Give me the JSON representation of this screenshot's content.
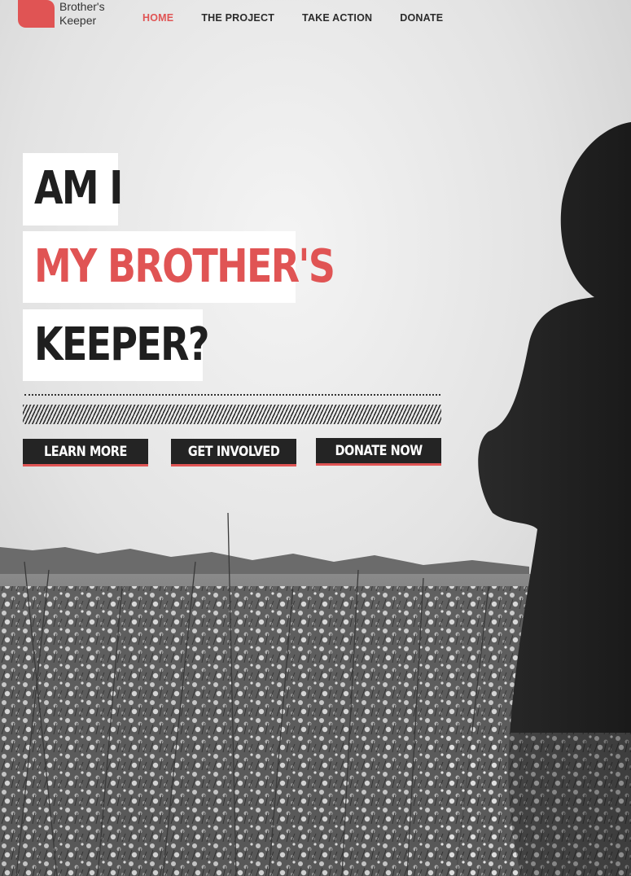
{
  "brand": {
    "name_line1": "Brother's",
    "name_line2": "Keeper",
    "accent_color": "#e05454",
    "logo_icon": "heart-icon"
  },
  "nav": {
    "items": [
      {
        "label": "HOME",
        "active": true
      },
      {
        "label": "THE PROJECT",
        "active": false
      },
      {
        "label": "TAKE ACTION",
        "active": false
      },
      {
        "label": "DONATE",
        "active": false
      }
    ]
  },
  "hero": {
    "line1": "AM I",
    "line2": "MY BROTHER'S",
    "line3": "KEEPER?",
    "buttons": {
      "learn_more": "LEARN MORE",
      "get_involved": "GET INVOLVED",
      "donate_now": "DONATE NOW"
    }
  },
  "colors": {
    "dark": "#242424",
    "accent": "#e05454",
    "block_bg": "#ffffff"
  }
}
